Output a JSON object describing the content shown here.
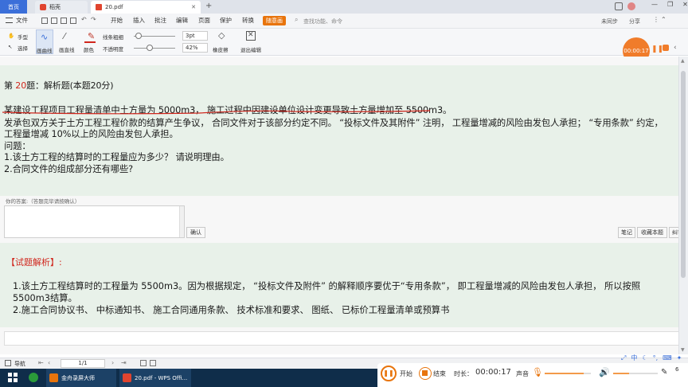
{
  "tabs": {
    "home": "首页",
    "docer": "稻壳",
    "file": "20.pdf",
    "add": "+"
  },
  "menu": {
    "file": "文件",
    "start": "开始",
    "insert": "插入",
    "annotate": "批注",
    "edit": "编辑",
    "page": "页面",
    "protect": "保护",
    "convert": "转换",
    "pen": "随意画",
    "search_placeholder": "查找功能、命令",
    "sync": "未同步",
    "share": "分享"
  },
  "ribbon": {
    "hand": "手型",
    "select": "选择",
    "curve": "画曲线",
    "line": "画直线",
    "color": "颜色",
    "thickness": "线条粗细",
    "opacity": "不透明度",
    "pt": "3pt",
    "percent": "42%",
    "eraser": "橡皮擦",
    "exit": "退出编辑"
  },
  "timer": "00:00:17",
  "question": {
    "heading": "第 20 题：解析题(本题20分)",
    "num": "20",
    "l1": "某建设工程项目工程量清单中土方量为 5000m3， 施工过程中因建设单位设计变更导致土方量增加至 5500m3。",
    "l2": "发承包双方关于土方工程工程价款的结算产生争议， 合同文件对于该部分约定不同。 “投标文件及其附件” 注明， 工程量增减的风险由发包人承担； “专用条款” 约定，",
    "l3": "工程量增减 10%以上的风险由发包人承担。",
    "l4": "问题：",
    "l5": "1.该土方工程的结算时的工程量应为多少？ 请说明理由。",
    "l6": "2.合同文件的组成部分还有哪些?"
  },
  "answer": {
    "label": "你的答案:（答题完毕请按确认）",
    "confirm": "确认",
    "notes": "笔记",
    "collect": "收藏本题",
    "error": "纠错"
  },
  "analysis": {
    "title": "【试题解析】:",
    "a1": "1.该土方工程结算时的工程量为 5500m3。因为根据规定， “投标文件及附件” 的解释顺序要优于“专用条款”， 即工程量增减的风险由发包人承担， 所以按照",
    "a2": "5500m3结算。",
    "a3": "2.施工合同协议书、 中标通知书、 施工合同通用条款、 技术标准和要求、 图纸、 已标价工程量清单或预算书"
  },
  "status": {
    "nav": "导航",
    "page": "1/1"
  },
  "taskbar": {
    "app1": "金舟录屏大师",
    "app2": "20.pdf - WPS Offi...",
    "ime": "中"
  },
  "recorder": {
    "start": "开始",
    "stop": "结束",
    "duration_label": "时长：",
    "duration": "00:00:17",
    "sound": "声音",
    "sound_level": 0.35,
    "mic_level": 0.85
  },
  "colors": {
    "accent": "#e8740c",
    "tab_active": "#ffffff",
    "text_red": "#d0261d",
    "bg_green": "#e8f1e9"
  }
}
